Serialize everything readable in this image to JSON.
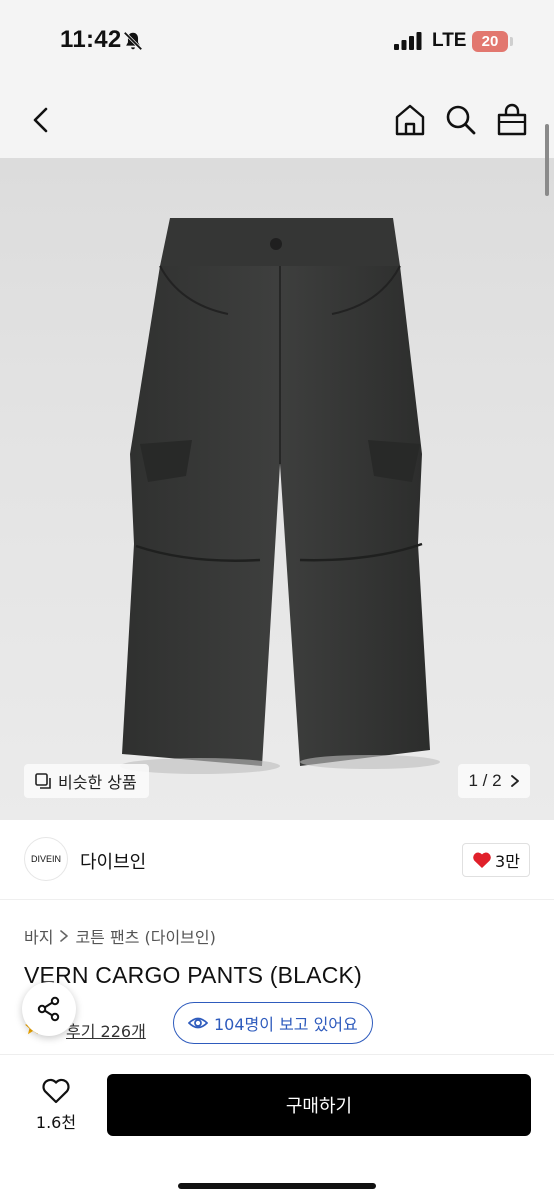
{
  "status_bar": {
    "time": "11:42",
    "network": "LTE",
    "battery": "20",
    "battery_color": "#e2776f"
  },
  "header": {
    "icons": [
      "back-icon",
      "home-icon",
      "search-icon",
      "shopping-bag-icon"
    ]
  },
  "gallery": {
    "similar_label": "비슷한 상품",
    "pager": "1 / 2"
  },
  "shop": {
    "logo_text": "DIVEIN",
    "name": "다이브인",
    "like_count": "3만",
    "like_color": "#e0202a"
  },
  "product": {
    "breadcrumb": [
      "바지",
      "코튼 팬츠 (다이브인)"
    ],
    "title": "VERN CARGO PANTS (BLACK)",
    "rating": "5",
    "reviews": "후기 226개",
    "viewing": "104명이 보고 있어요",
    "accent_color": "#2e5bbd"
  },
  "bottom_bar": {
    "wish_count": "1.6천",
    "buy_label": "구매하기"
  }
}
